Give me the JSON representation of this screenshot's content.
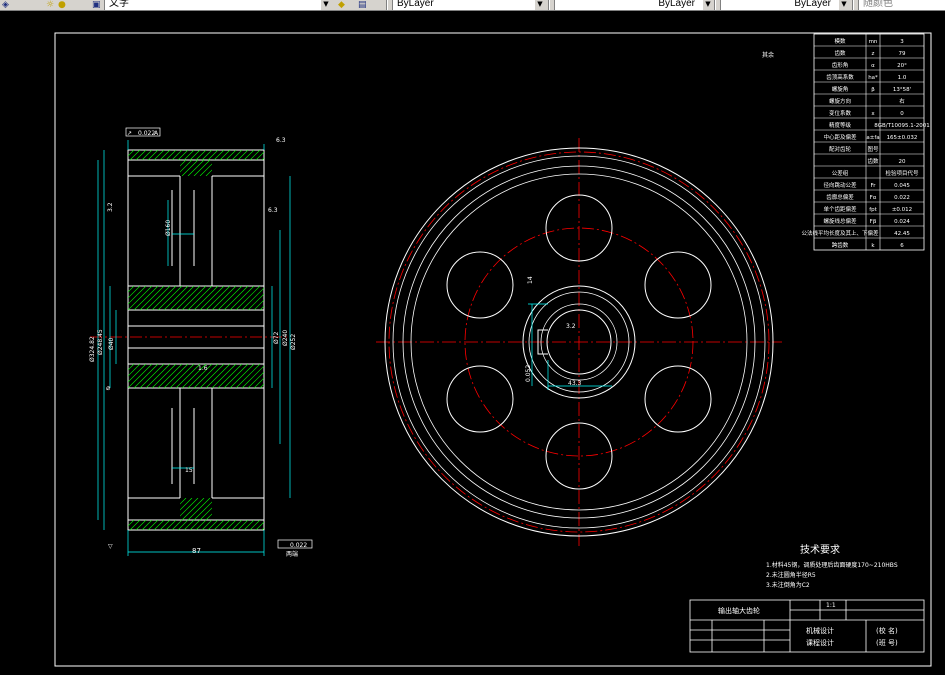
{
  "toolbar": {
    "text_style": "文字",
    "layer_1": "ByLayer",
    "layer_2": "ByLayer",
    "layer_3": "ByLayer",
    "color_field": "随颜色",
    "icons": [
      "layer-icon",
      "sun-icon",
      "lightbulb-icon",
      "layer-state-icon",
      "layer-prev-icon"
    ]
  },
  "colors": {
    "outline": "#ffffff",
    "centerline": "#ff0000",
    "dimension": "#00ffff",
    "hatch": "#00ff00",
    "hole": "#ffffff"
  },
  "section_view": {
    "tolerance_top": "0.022",
    "tolerance_bottom": "0.022",
    "roughness_top": "6.3",
    "roughness_side": "6.3",
    "roughness_left": "3.2",
    "roughness_mid": "1.6",
    "width_dim": "87",
    "web_dim": "15",
    "hub_dim": "Ø72",
    "bore_label": "Ø40",
    "od_label_1": "Ø240",
    "od_label_2": "Ø252",
    "side_label_a": "Ø248.45",
    "side_label_b": "Ø324.82",
    "pcd_label": "Ø160",
    "keyway_label": "14",
    "datum_a": "A",
    "bottom_note": "两端"
  },
  "front_view": {
    "keyway_width": "14",
    "keyway_depth": "43.3",
    "roughness": "3.2",
    "keyway_tol": "0.052"
  },
  "gear_table": {
    "rows": [
      {
        "label": "模数",
        "symbol": "mn",
        "value": "3"
      },
      {
        "label": "齿数",
        "symbol": "z",
        "value": "79"
      },
      {
        "label": "齿形角",
        "symbol": "α",
        "value": "20°"
      },
      {
        "label": "齿顶高系数",
        "symbol": "ha*",
        "value": "1.0"
      },
      {
        "label": "螺旋角",
        "symbol": "β",
        "value": "13°58'"
      },
      {
        "label": "螺旋方向",
        "symbol": "",
        "value": "右"
      },
      {
        "label": "变位系数",
        "symbol": "x",
        "value": "0"
      },
      {
        "label": "精度等级",
        "symbol": "",
        "value": "8GB/T10095.1-2001"
      },
      {
        "label": "中心距及偏差",
        "symbol": "a±fa",
        "value": "165±0.032"
      },
      {
        "label": "配对齿轮",
        "symbol": "图号",
        "value": ""
      },
      {
        "label": "",
        "symbol": "齿数",
        "value": "20"
      },
      {
        "label": "公差组",
        "symbol": "",
        "value": "检验项目代号"
      },
      {
        "label": "径向跳动公差",
        "symbol": "Fr",
        "value": "0.045"
      },
      {
        "label": "齿廓总偏差",
        "symbol": "Fα",
        "value": "0.022"
      },
      {
        "label": "单个齿距偏差",
        "symbol": "fpt",
        "value": "±0.012"
      },
      {
        "label": "螺旋线总偏差",
        "symbol": "Fβ",
        "value": "0.024"
      },
      {
        "label": "公法线平均长度及其上、下偏差",
        "symbol": "",
        "value": "42.45"
      },
      {
        "label": "跨齿数",
        "symbol": "k",
        "value": "6"
      }
    ],
    "other_roughness": "其余"
  },
  "tech_req": {
    "title": "技术要求",
    "lines": [
      "1.材料45钢，调质处理后齿面硬度170~210HBS",
      "2.未注圆角半径R5",
      "3.未注倒角为C2"
    ]
  },
  "title_block": {
    "part_name": "输出轴大齿轮",
    "scale": "1:1",
    "course_1": "机械设计",
    "course_2": "课程设计",
    "school": "(校 名)",
    "class": "(班 号)"
  }
}
